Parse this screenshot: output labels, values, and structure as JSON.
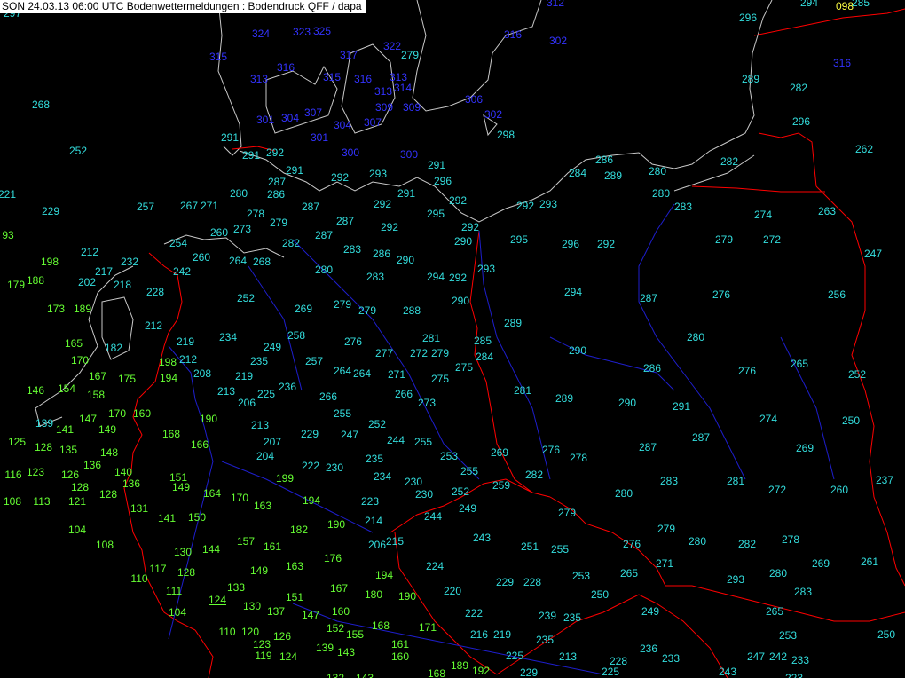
{
  "title": "SON 24.03.13 06:00 UTC  Bodenwettermeldungen :  Bodendruck QFF / dapa",
  "colors": {
    "background": "#000000",
    "coast": "#c8c8c8",
    "border": "#ff0000",
    "river": "#1e1ecc",
    "sea_value": "#3333ff",
    "high_value": "#33dddd",
    "low_value": "#66ff33",
    "special_value": "#ffff44"
  },
  "stations": [
    {
      "v": "297",
      "c": "high_value"
    },
    {
      "v": "312",
      "c": "sea_value"
    },
    {
      "v": "294",
      "c": "high_value"
    },
    {
      "v": "098",
      "c": "special_value"
    },
    {
      "v": "285",
      "c": "high_value"
    },
    {
      "v": "296",
      "c": "high_value"
    },
    {
      "v": "324",
      "c": "sea_value"
    },
    {
      "v": "323",
      "c": "sea_value"
    },
    {
      "v": "325",
      "c": "sea_value"
    },
    {
      "v": "316",
      "c": "sea_value"
    },
    {
      "v": "302",
      "c": "sea_value"
    },
    {
      "v": "322",
      "c": "sea_value"
    },
    {
      "v": "315",
      "c": "sea_value"
    },
    {
      "v": "316",
      "c": "sea_value"
    },
    {
      "v": "317",
      "c": "sea_value"
    },
    {
      "v": "279",
      "c": "high_value"
    },
    {
      "v": "316",
      "c": "sea_value"
    },
    {
      "v": "313",
      "c": "sea_value"
    },
    {
      "v": "313",
      "c": "sea_value"
    },
    {
      "v": "315",
      "c": "sea_value"
    },
    {
      "v": "316",
      "c": "sea_value"
    },
    {
      "v": "289",
      "c": "high_value"
    },
    {
      "v": "282",
      "c": "high_value"
    },
    {
      "v": "313",
      "c": "sea_value"
    },
    {
      "v": "314",
      "c": "sea_value"
    },
    {
      "v": "306",
      "c": "sea_value"
    },
    {
      "v": "268",
      "c": "high_value"
    },
    {
      "v": "309",
      "c": "sea_value"
    },
    {
      "v": "309",
      "c": "sea_value"
    },
    {
      "v": "307",
      "c": "sea_value"
    },
    {
      "v": "302",
      "c": "sea_value"
    },
    {
      "v": "296",
      "c": "high_value"
    },
    {
      "v": "301",
      "c": "sea_value"
    },
    {
      "v": "304",
      "c": "sea_value"
    },
    {
      "v": "304",
      "c": "sea_value"
    },
    {
      "v": "307",
      "c": "sea_value"
    },
    {
      "v": "298",
      "c": "high_value"
    },
    {
      "v": "291",
      "c": "high_value"
    },
    {
      "v": "301",
      "c": "sea_value"
    },
    {
      "v": "252",
      "c": "high_value"
    },
    {
      "v": "291",
      "c": "high_value"
    },
    {
      "v": "292",
      "c": "high_value"
    },
    {
      "v": "300",
      "c": "sea_value"
    },
    {
      "v": "300",
      "c": "sea_value"
    },
    {
      "v": "262",
      "c": "high_value"
    },
    {
      "v": "286",
      "c": "high_value"
    },
    {
      "v": "282",
      "c": "high_value"
    },
    {
      "v": "291",
      "c": "high_value"
    },
    {
      "v": "293",
      "c": "high_value"
    },
    {
      "v": "291",
      "c": "high_value"
    },
    {
      "v": "284",
      "c": "high_value"
    },
    {
      "v": "289",
      "c": "high_value"
    },
    {
      "v": "280",
      "c": "high_value"
    },
    {
      "v": "292",
      "c": "high_value"
    },
    {
      "v": "287",
      "c": "high_value"
    },
    {
      "v": "296",
      "c": "high_value"
    },
    {
      "v": "221",
      "c": "high_value"
    },
    {
      "v": "280",
      "c": "high_value"
    },
    {
      "v": "286",
      "c": "high_value"
    },
    {
      "v": "291",
      "c": "high_value"
    },
    {
      "v": "280",
      "c": "high_value"
    },
    {
      "v": "229",
      "c": "high_value"
    },
    {
      "v": "257",
      "c": "high_value"
    },
    {
      "v": "267",
      "c": "high_value"
    },
    {
      "v": "271",
      "c": "high_value"
    },
    {
      "v": "287",
      "c": "high_value"
    },
    {
      "v": "292",
      "c": "high_value"
    },
    {
      "v": "292",
      "c": "high_value"
    },
    {
      "v": "292",
      "c": "high_value"
    },
    {
      "v": "293",
      "c": "high_value"
    },
    {
      "v": "283",
      "c": "high_value"
    },
    {
      "v": "274",
      "c": "high_value"
    },
    {
      "v": "263",
      "c": "high_value"
    },
    {
      "v": "278",
      "c": "high_value"
    },
    {
      "v": "279",
      "c": "high_value"
    },
    {
      "v": "287",
      "c": "high_value"
    },
    {
      "v": "295",
      "c": "high_value"
    },
    {
      "v": "93",
      "c": "low_value"
    },
    {
      "v": "260",
      "c": "high_value"
    },
    {
      "v": "273",
      "c": "high_value"
    },
    {
      "v": "292",
      "c": "high_value"
    },
    {
      "v": "292",
      "c": "high_value"
    },
    {
      "v": "287",
      "c": "high_value"
    },
    {
      "v": "282",
      "c": "high_value"
    },
    {
      "v": "290",
      "c": "high_value"
    },
    {
      "v": "295",
      "c": "high_value"
    },
    {
      "v": "296",
      "c": "high_value"
    },
    {
      "v": "292",
      "c": "high_value"
    },
    {
      "v": "279",
      "c": "high_value"
    },
    {
      "v": "272",
      "c": "high_value"
    },
    {
      "v": "254",
      "c": "high_value"
    },
    {
      "v": "283",
      "c": "high_value"
    },
    {
      "v": "212",
      "c": "high_value"
    },
    {
      "v": "286",
      "c": "high_value"
    },
    {
      "v": "247",
      "c": "high_value"
    },
    {
      "v": "198",
      "c": "low_value"
    },
    {
      "v": "260",
      "c": "high_value"
    },
    {
      "v": "264",
      "c": "high_value"
    },
    {
      "v": "268",
      "c": "high_value"
    },
    {
      "v": "290",
      "c": "high_value"
    },
    {
      "v": "232",
      "c": "high_value"
    },
    {
      "v": "293",
      "c": "high_value"
    },
    {
      "v": "217",
      "c": "high_value"
    },
    {
      "v": "242",
      "c": "high_value"
    },
    {
      "v": "280",
      "c": "high_value"
    },
    {
      "v": "294",
      "c": "high_value"
    },
    {
      "v": "292",
      "c": "high_value"
    },
    {
      "v": "188",
      "c": "low_value"
    },
    {
      "v": "179",
      "c": "low_value"
    },
    {
      "v": "202",
      "c": "high_value"
    },
    {
      "v": "218",
      "c": "high_value"
    },
    {
      "v": "283",
      "c": "high_value"
    },
    {
      "v": "294",
      "c": "high_value"
    },
    {
      "v": "228",
      "c": "high_value"
    },
    {
      "v": "276",
      "c": "high_value"
    },
    {
      "v": "256",
      "c": "high_value"
    },
    {
      "v": "252",
      "c": "high_value"
    },
    {
      "v": "287",
      "c": "high_value"
    },
    {
      "v": "290",
      "c": "high_value"
    },
    {
      "v": "173",
      "c": "low_value"
    },
    {
      "v": "189",
      "c": "low_value"
    },
    {
      "v": "269",
      "c": "high_value"
    },
    {
      "v": "279",
      "c": "high_value"
    },
    {
      "v": "279",
      "c": "high_value"
    },
    {
      "v": "288",
      "c": "high_value"
    },
    {
      "v": "289",
      "c": "high_value"
    },
    {
      "v": "212",
      "c": "high_value"
    },
    {
      "v": "234",
      "c": "high_value"
    },
    {
      "v": "258",
      "c": "high_value"
    },
    {
      "v": "280",
      "c": "high_value"
    },
    {
      "v": "165",
      "c": "low_value"
    },
    {
      "v": "219",
      "c": "high_value"
    },
    {
      "v": "276",
      "c": "high_value"
    },
    {
      "v": "281",
      "c": "high_value"
    },
    {
      "v": "285",
      "c": "high_value"
    },
    {
      "v": "182",
      "c": "high_value"
    },
    {
      "v": "249",
      "c": "high_value"
    },
    {
      "v": "277",
      "c": "high_value"
    },
    {
      "v": "272",
      "c": "high_value"
    },
    {
      "v": "279",
      "c": "high_value"
    },
    {
      "v": "290",
      "c": "high_value"
    },
    {
      "v": "170",
      "c": "low_value"
    },
    {
      "v": "198",
      "c": "low_value"
    },
    {
      "v": "212",
      "c": "high_value"
    },
    {
      "v": "235",
      "c": "high_value"
    },
    {
      "v": "257",
      "c": "high_value"
    },
    {
      "v": "284",
      "c": "high_value"
    },
    {
      "v": "265",
      "c": "high_value"
    },
    {
      "v": "208",
      "c": "high_value"
    },
    {
      "v": "264",
      "c": "high_value"
    },
    {
      "v": "264",
      "c": "high_value"
    },
    {
      "v": "271",
      "c": "high_value"
    },
    {
      "v": "275",
      "c": "high_value"
    },
    {
      "v": "286",
      "c": "high_value"
    },
    {
      "v": "276",
      "c": "high_value"
    },
    {
      "v": "167",
      "c": "low_value"
    },
    {
      "v": "175",
      "c": "low_value"
    },
    {
      "v": "194",
      "c": "low_value"
    },
    {
      "v": "219",
      "c": "high_value"
    },
    {
      "v": "275",
      "c": "high_value"
    },
    {
      "v": "252",
      "c": "high_value"
    },
    {
      "v": "146",
      "c": "low_value"
    },
    {
      "v": "154",
      "c": "low_value"
    },
    {
      "v": "158",
      "c": "low_value"
    },
    {
      "v": "213",
      "c": "high_value"
    },
    {
      "v": "225",
      "c": "high_value"
    },
    {
      "v": "236",
      "c": "high_value"
    },
    {
      "v": "266",
      "c": "high_value"
    },
    {
      "v": "281",
      "c": "high_value"
    },
    {
      "v": "289",
      "c": "high_value"
    },
    {
      "v": "206",
      "c": "high_value"
    },
    {
      "v": "266",
      "c": "high_value"
    },
    {
      "v": "273",
      "c": "high_value"
    },
    {
      "v": "290",
      "c": "high_value"
    },
    {
      "v": "291",
      "c": "high_value"
    },
    {
      "v": "170",
      "c": "low_value"
    },
    {
      "v": "160",
      "c": "low_value"
    },
    {
      "v": "255",
      "c": "high_value"
    },
    {
      "v": "274",
      "c": "high_value"
    },
    {
      "v": "139",
      "c": "high_value"
    },
    {
      "v": "147",
      "c": "low_value"
    },
    {
      "v": "190",
      "c": "low_value"
    },
    {
      "v": "213",
      "c": "high_value"
    },
    {
      "v": "252",
      "c": "high_value"
    },
    {
      "v": "250",
      "c": "high_value"
    },
    {
      "v": "141",
      "c": "low_value"
    },
    {
      "v": "149",
      "c": "low_value"
    },
    {
      "v": "247",
      "c": "high_value"
    },
    {
      "v": "168",
      "c": "low_value"
    },
    {
      "v": "229",
      "c": "high_value"
    },
    {
      "v": "244",
      "c": "high_value"
    },
    {
      "v": "255",
      "c": "high_value"
    },
    {
      "v": "287",
      "c": "high_value"
    },
    {
      "v": "125",
      "c": "low_value"
    },
    {
      "v": "128",
      "c": "low_value"
    },
    {
      "v": "135",
      "c": "low_value"
    },
    {
      "v": "166",
      "c": "low_value"
    },
    {
      "v": "207",
      "c": "high_value"
    },
    {
      "v": "287",
      "c": "high_value"
    },
    {
      "v": "269",
      "c": "high_value"
    },
    {
      "v": "148",
      "c": "low_value"
    },
    {
      "v": "204",
      "c": "high_value"
    },
    {
      "v": "253",
      "c": "high_value"
    },
    {
      "v": "269",
      "c": "high_value"
    },
    {
      "v": "276",
      "c": "high_value"
    },
    {
      "v": "278",
      "c": "high_value"
    },
    {
      "v": "136",
      "c": "low_value"
    },
    {
      "v": "235",
      "c": "high_value"
    },
    {
      "v": "116",
      "c": "low_value"
    },
    {
      "v": "123",
      "c": "low_value"
    },
    {
      "v": "126",
      "c": "low_value"
    },
    {
      "v": "140",
      "c": "low_value"
    },
    {
      "v": "222",
      "c": "high_value"
    },
    {
      "v": "230",
      "c": "high_value"
    },
    {
      "v": "255",
      "c": "high_value"
    },
    {
      "v": "282",
      "c": "high_value"
    },
    {
      "v": "151",
      "c": "low_value"
    },
    {
      "v": "234",
      "c": "high_value"
    },
    {
      "v": "237",
      "c": "high_value"
    },
    {
      "v": "136",
      "c": "low_value"
    },
    {
      "v": "199",
      "c": "low_value"
    },
    {
      "v": "283",
      "c": "high_value"
    },
    {
      "v": "281",
      "c": "high_value"
    },
    {
      "v": "128",
      "c": "low_value"
    },
    {
      "v": "149",
      "c": "low_value"
    },
    {
      "v": "230",
      "c": "high_value"
    },
    {
      "v": "259",
      "c": "high_value"
    },
    {
      "v": "272",
      "c": "high_value"
    },
    {
      "v": "260",
      "c": "high_value"
    },
    {
      "v": "128",
      "c": "low_value"
    },
    {
      "v": "230",
      "c": "high_value"
    },
    {
      "v": "252",
      "c": "high_value"
    },
    {
      "v": "280",
      "c": "high_value"
    },
    {
      "v": "164",
      "c": "low_value"
    },
    {
      "v": "108",
      "c": "low_value"
    },
    {
      "v": "113",
      "c": "low_value"
    },
    {
      "v": "121",
      "c": "low_value"
    },
    {
      "v": "170",
      "c": "low_value"
    },
    {
      "v": "194",
      "c": "low_value"
    },
    {
      "v": "223",
      "c": "high_value"
    },
    {
      "v": "163",
      "c": "low_value"
    },
    {
      "v": "249",
      "c": "high_value"
    },
    {
      "v": "131",
      "c": "low_value"
    },
    {
      "v": "279",
      "c": "high_value"
    },
    {
      "v": "141",
      "c": "low_value"
    },
    {
      "v": "150",
      "c": "low_value"
    },
    {
      "v": "214",
      "c": "high_value"
    },
    {
      "v": "244",
      "c": "high_value"
    },
    {
      "v": "190",
      "c": "low_value"
    },
    {
      "v": "279",
      "c": "high_value"
    },
    {
      "v": "104",
      "c": "low_value"
    },
    {
      "v": "182",
      "c": "low_value"
    },
    {
      "v": "243",
      "c": "high_value"
    },
    {
      "v": "215",
      "c": "high_value"
    },
    {
      "v": "206",
      "c": "high_value"
    },
    {
      "v": "157",
      "c": "low_value"
    },
    {
      "v": "161",
      "c": "low_value"
    },
    {
      "v": "251",
      "c": "high_value"
    },
    {
      "v": "276",
      "c": "high_value"
    },
    {
      "v": "280",
      "c": "high_value"
    },
    {
      "v": "282",
      "c": "high_value"
    },
    {
      "v": "278",
      "c": "high_value"
    },
    {
      "v": "108",
      "c": "low_value"
    },
    {
      "v": "130",
      "c": "low_value"
    },
    {
      "v": "144",
      "c": "low_value"
    },
    {
      "v": "255",
      "c": "high_value"
    },
    {
      "v": "176",
      "c": "low_value"
    },
    {
      "v": "271",
      "c": "high_value"
    },
    {
      "v": "269",
      "c": "high_value"
    },
    {
      "v": "261",
      "c": "high_value"
    },
    {
      "v": "117",
      "c": "low_value"
    },
    {
      "v": "149",
      "c": "low_value"
    },
    {
      "v": "163",
      "c": "low_value"
    },
    {
      "v": "224",
      "c": "high_value"
    },
    {
      "v": "194",
      "c": "low_value"
    },
    {
      "v": "110",
      "c": "low_value"
    },
    {
      "v": "128",
      "c": "low_value"
    },
    {
      "v": "229",
      "c": "high_value"
    },
    {
      "v": "228",
      "c": "high_value"
    },
    {
      "v": "253",
      "c": "high_value"
    },
    {
      "v": "265",
      "c": "high_value"
    },
    {
      "v": "280",
      "c": "high_value"
    },
    {
      "v": "293",
      "c": "high_value"
    },
    {
      "v": "133",
      "c": "low_value"
    },
    {
      "v": "167",
      "c": "low_value"
    },
    {
      "v": "111",
      "c": "low_value"
    },
    {
      "v": "180",
      "c": "low_value"
    },
    {
      "v": "220",
      "c": "high_value"
    },
    {
      "v": "250",
      "c": "high_value"
    },
    {
      "v": "283",
      "c": "high_value"
    },
    {
      "v": "124",
      "c": "low_value",
      "u": true
    },
    {
      "v": "151",
      "c": "low_value"
    },
    {
      "v": "190",
      "c": "low_value"
    },
    {
      "v": "130",
      "c": "low_value"
    },
    {
      "v": "104",
      "c": "low_value"
    },
    {
      "v": "137",
      "c": "low_value"
    },
    {
      "v": "147",
      "c": "low_value"
    },
    {
      "v": "160",
      "c": "low_value"
    },
    {
      "v": "249",
      "c": "high_value"
    },
    {
      "v": "222",
      "c": "high_value"
    },
    {
      "v": "239",
      "c": "high_value"
    },
    {
      "v": "235",
      "c": "high_value"
    },
    {
      "v": "265",
      "c": "high_value"
    },
    {
      "v": "171",
      "c": "low_value"
    },
    {
      "v": "168",
      "c": "low_value"
    },
    {
      "v": "152",
      "c": "low_value"
    },
    {
      "v": "110",
      "c": "low_value"
    },
    {
      "v": "120",
      "c": "low_value"
    },
    {
      "v": "126",
      "c": "low_value"
    },
    {
      "v": "155",
      "c": "low_value"
    },
    {
      "v": "216",
      "c": "high_value"
    },
    {
      "v": "219",
      "c": "high_value"
    },
    {
      "v": "235",
      "c": "high_value"
    },
    {
      "v": "253",
      "c": "high_value"
    },
    {
      "v": "250",
      "c": "high_value"
    },
    {
      "v": "161",
      "c": "low_value"
    },
    {
      "v": "123",
      "c": "low_value"
    },
    {
      "v": "139",
      "c": "low_value"
    },
    {
      "v": "236",
      "c": "high_value"
    },
    {
      "v": "143",
      "c": "low_value"
    },
    {
      "v": "160",
      "c": "low_value"
    },
    {
      "v": "119",
      "c": "low_value"
    },
    {
      "v": "124",
      "c": "low_value"
    },
    {
      "v": "225",
      "c": "high_value"
    },
    {
      "v": "213",
      "c": "high_value"
    },
    {
      "v": "228",
      "c": "high_value"
    },
    {
      "v": "233",
      "c": "high_value"
    },
    {
      "v": "247",
      "c": "high_value"
    },
    {
      "v": "242",
      "c": "high_value"
    },
    {
      "v": "233",
      "c": "high_value"
    },
    {
      "v": "189",
      "c": "low_value"
    },
    {
      "v": "192",
      "c": "low_value"
    },
    {
      "v": "168",
      "c": "low_value"
    },
    {
      "v": "229",
      "c": "high_value"
    },
    {
      "v": "225",
      "c": "high_value"
    },
    {
      "v": "243",
      "c": "high_value"
    },
    {
      "v": "132",
      "c": "low_value"
    },
    {
      "v": "143",
      "c": "low_value"
    },
    {
      "v": "223",
      "c": "high_value"
    }
  ]
}
